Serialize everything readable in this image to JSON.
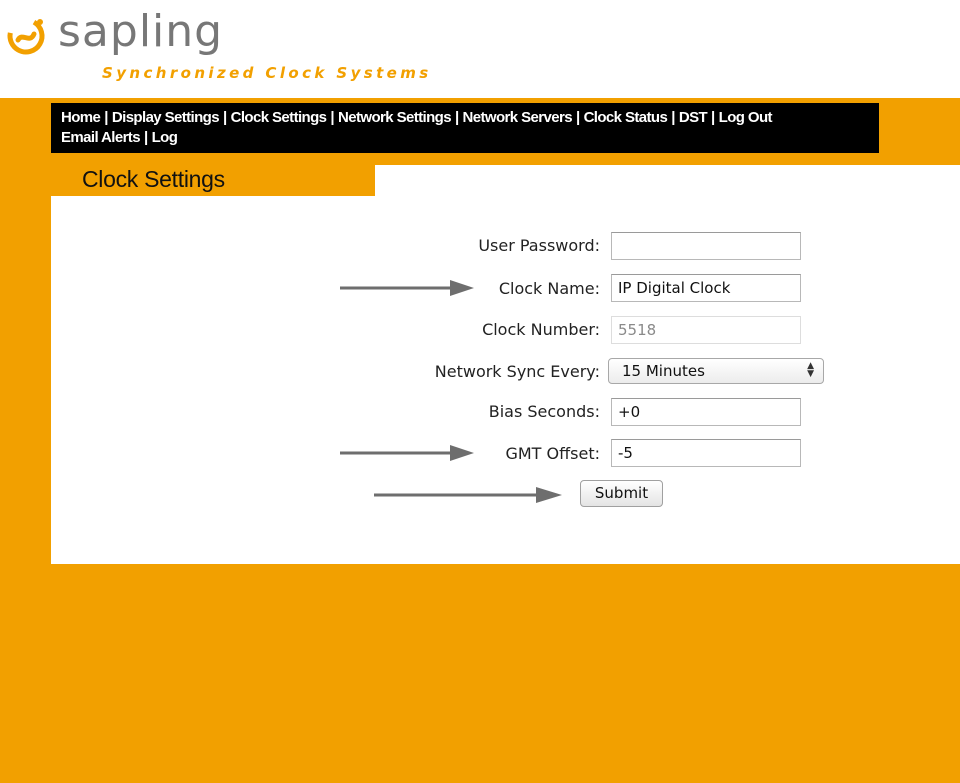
{
  "brand": {
    "name": "sapling",
    "tagline": "Synchronized Clock Systems",
    "color": "#f2a000"
  },
  "nav": {
    "items": [
      {
        "label": "Home"
      },
      {
        "label": "Display Settings"
      },
      {
        "label": "Clock Settings"
      },
      {
        "label": "Network Settings"
      },
      {
        "label": "Network Servers"
      },
      {
        "label": "Clock Status"
      },
      {
        "label": "DST"
      },
      {
        "label": "Log Out"
      },
      {
        "label": "Email Alerts"
      },
      {
        "label": "Log"
      }
    ],
    "separator": "|"
  },
  "section": {
    "title": "Clock Settings"
  },
  "form": {
    "user_password": {
      "label": "User Password:",
      "value": ""
    },
    "clock_name": {
      "label": "Clock Name:",
      "value": "IP Digital Clock"
    },
    "clock_number": {
      "label": "Clock Number:",
      "value": "5518"
    },
    "network_sync": {
      "label": "Network Sync Every:",
      "selected": "15 Minutes"
    },
    "bias_seconds": {
      "label": "Bias Seconds:",
      "value": "+0"
    },
    "gmt_offset": {
      "label": "GMT Offset:",
      "value": "-5"
    },
    "submit_label": "Submit"
  },
  "annotations": {
    "arrow_color": "#6e6e6e"
  },
  "icons": {
    "logo": "sapling-swirl-logo-icon",
    "select_arrows": "updown-chevron-icon",
    "annotation_arrow": "arrow-right-icon"
  }
}
